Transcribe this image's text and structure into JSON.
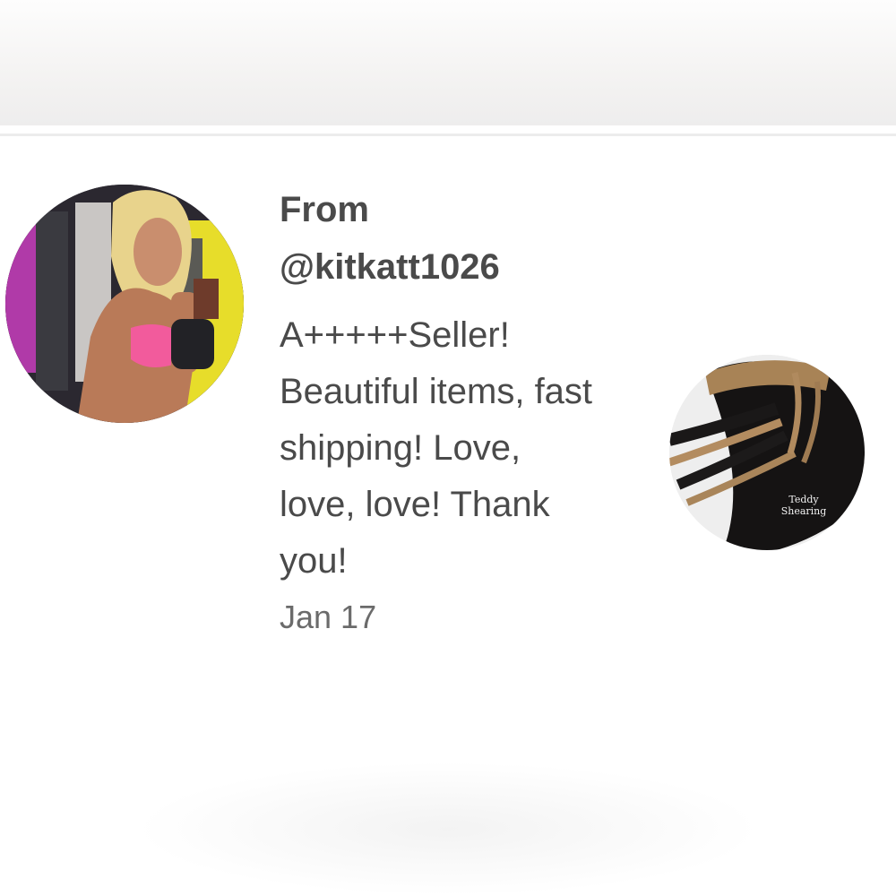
{
  "review": {
    "from_label": "From",
    "username": "@kitkatt1026",
    "message": "A+++++Seller! Beautiful items, fast shipping! Love, love, love! Thank you!",
    "date": "Jan 17"
  },
  "product": {
    "caption_line1": "Teddy",
    "caption_line2": "Shearing"
  },
  "colors": {
    "text": "#4a4a4a",
    "date_text": "#6b6b6b",
    "background": "#ffffff"
  }
}
